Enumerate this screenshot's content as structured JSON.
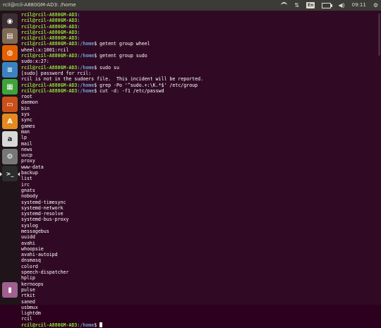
{
  "panel": {
    "title": "rcil@rcil-A880GM-AD3: /home",
    "time": "09:11",
    "keyboard": "En",
    "icons": [
      "wifi-icon",
      "transfer-icon",
      "keyboard-icon",
      "battery-icon",
      "volume-icon",
      "settings-icon"
    ]
  },
  "launcher": {
    "items": [
      {
        "name": "ubuntu-dash",
        "color": "#3a2d33"
      },
      {
        "name": "files",
        "color": "#7f6a55"
      },
      {
        "name": "firefox",
        "color": "#e66000"
      },
      {
        "name": "libreoffice-writer",
        "color": "#3b83c0"
      },
      {
        "name": "libreoffice-calc",
        "color": "#3fa33a"
      },
      {
        "name": "libreoffice-impress",
        "color": "#c9501b"
      },
      {
        "name": "ubuntu-software",
        "color": "#e58a1f"
      },
      {
        "name": "amazon",
        "color": "#d8d8d8"
      },
      {
        "name": "system-settings",
        "color": "#777777"
      },
      {
        "name": "terminal",
        "color": "#2c2c2c"
      },
      {
        "name": "trash",
        "color": "#a06090"
      }
    ]
  },
  "terminal": {
    "prompt_user": "rcil@rcil-A880GM-AD3",
    "lines": [
      {
        "user": "rcil@rcil-A880GM-AD3",
        "path": ":",
        "cmd": ""
      },
      {
        "user": "rcil@rcil-A880GM-AD3",
        "path": ":",
        "cmd": ""
      },
      {
        "user": "rcil@rcil-A880GM-AD3",
        "path": ":",
        "cmd": ""
      },
      {
        "user": "rcil@rcil-A880GM-AD3",
        "path": ":",
        "cmd": ""
      },
      {
        "user": "rcil@rcil-A880GM-AD3",
        "path": ":",
        "cmd": ""
      },
      {
        "user": "rcil@rcil-A880GM-AD3",
        "path": ":/home",
        "cmd": "$ getent group wheel"
      },
      {
        "text": "wheel:x:1001:rcil"
      },
      {
        "user": "rcil@rcil-A880GM-AD3",
        "path": ":/home",
        "cmd": "$ getent group sudo"
      },
      {
        "text": "sudo:x:27:"
      },
      {
        "user": "rcil@rcil-A880GM-AD3",
        "path": ":/home",
        "cmd": "$ sudo su"
      },
      {
        "text": "[sudo] password for rcil:"
      },
      {
        "text": "rcil is not in the sudoers file.  This incident will be reported."
      },
      {
        "user": "rcil@rcil-A880GM-AD3",
        "path": ":/home",
        "cmd": "$ grep -Po '^sudo.+:\\K.*$' /etc/group"
      },
      {
        "user": "rcil@rcil-A880GM-AD3",
        "path": ":/home",
        "cmd": "$ cut -d: -f1 /etc/passwd"
      },
      {
        "text": "root"
      },
      {
        "text": "daemon"
      },
      {
        "text": "bin"
      },
      {
        "text": "sys"
      },
      {
        "text": "sync"
      },
      {
        "text": "games"
      },
      {
        "text": "man"
      },
      {
        "text": "lp"
      },
      {
        "text": "mail"
      },
      {
        "text": "news"
      },
      {
        "text": "uucp"
      },
      {
        "text": "proxy"
      },
      {
        "text": "www-data"
      },
      {
        "text": "backup"
      },
      {
        "text": "list"
      },
      {
        "text": "irc"
      },
      {
        "text": "gnats"
      },
      {
        "text": "nobody"
      },
      {
        "text": "systemd-timesync"
      },
      {
        "text": "systemd-network"
      },
      {
        "text": "systemd-resolve"
      },
      {
        "text": "systemd-bus-proxy"
      },
      {
        "text": "syslog"
      },
      {
        "text": "messagebus"
      },
      {
        "text": "uuidd"
      },
      {
        "text": "avahi"
      },
      {
        "text": "whoopsie"
      },
      {
        "text": "avahi-autoipd"
      },
      {
        "text": "dnsmasq"
      },
      {
        "text": "colord"
      },
      {
        "text": "speech-dispatcher"
      },
      {
        "text": "hplip"
      },
      {
        "text": "kernoops"
      },
      {
        "text": "pulse"
      },
      {
        "text": "rtkit"
      },
      {
        "text": "saned"
      },
      {
        "text": "usbmux"
      },
      {
        "text": "lightdm"
      },
      {
        "text": "rcil"
      },
      {
        "user": "rcil@rcil-A880GM-AD3",
        "path": ":/home",
        "cmd": "$ ",
        "cursor": true
      }
    ]
  }
}
